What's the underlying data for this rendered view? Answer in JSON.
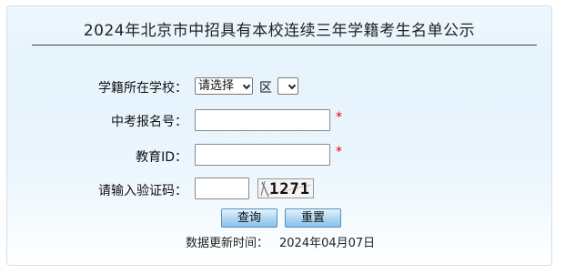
{
  "title": "2024年北京市中招具有本校连续三年学籍考生名单公示",
  "form": {
    "school_label": "学籍所在学校：",
    "district_select_value": "请选择",
    "district_suffix": "区",
    "school_select_value": "",
    "exam_number_label": "中考报名号：",
    "education_id_label": "教育ID：",
    "captcha_label": "请输入验证码：",
    "captcha_code": "1271",
    "required_mark": "*"
  },
  "buttons": {
    "query": "查询",
    "reset": "重置"
  },
  "footer": {
    "update_label": "数据更新时间：",
    "update_date": "2024年04月07日"
  },
  "icons": {
    "select_arrow": "chevron-down-icon"
  }
}
